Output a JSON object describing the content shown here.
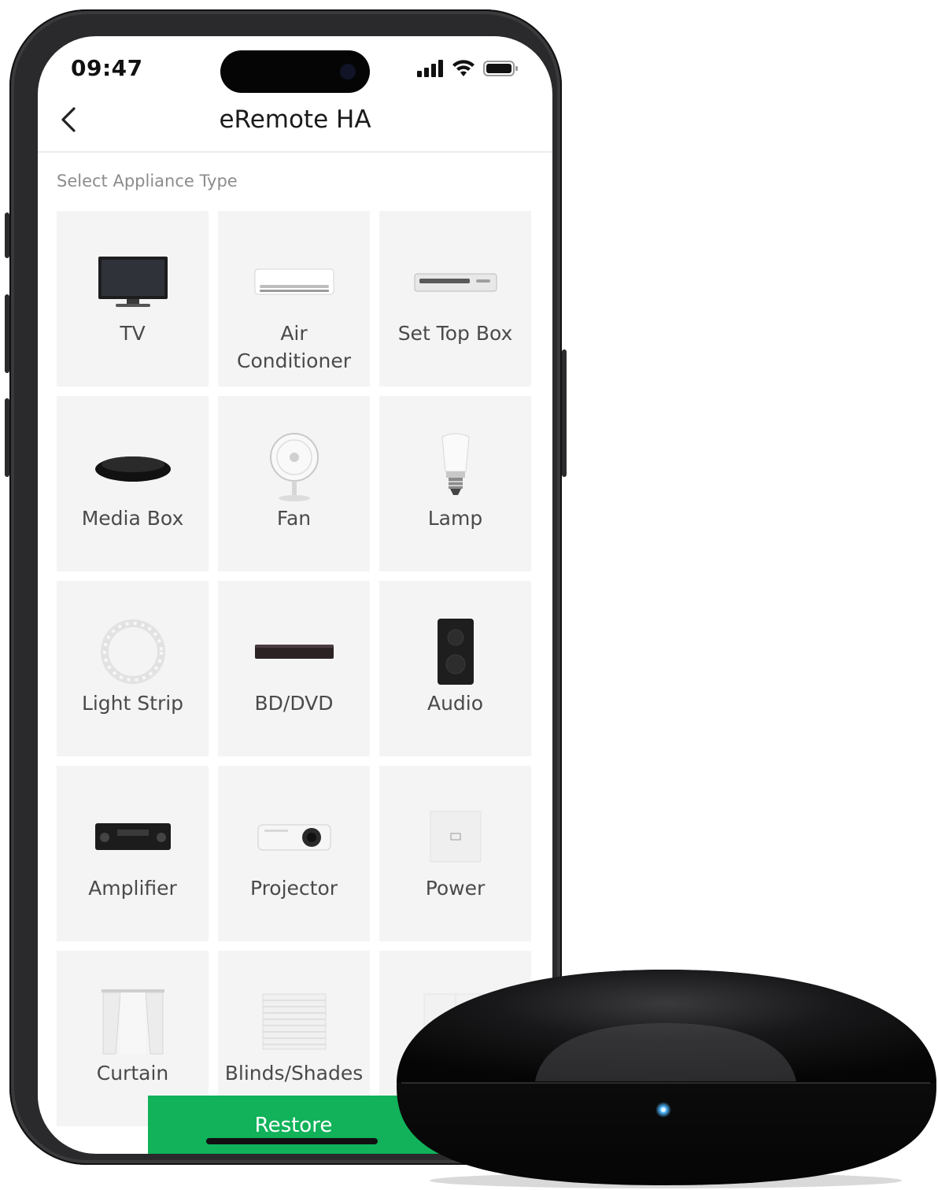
{
  "status_bar": {
    "time": "09:47",
    "icons": [
      "signal-icon",
      "wifi-icon",
      "battery-icon"
    ]
  },
  "header": {
    "back_icon": "chevron-left-icon",
    "title": "eRemote HA"
  },
  "section_label": "Select Appliance Type",
  "appliances": [
    {
      "label": "TV",
      "icon": "tv-icon"
    },
    {
      "label": "Air Conditioner",
      "icon": "air-conditioner-icon"
    },
    {
      "label": "Set Top Box",
      "icon": "set-top-box-icon"
    },
    {
      "label": "Media Box",
      "icon": "media-box-icon"
    },
    {
      "label": "Fan",
      "icon": "fan-icon"
    },
    {
      "label": "Lamp",
      "icon": "lamp-icon"
    },
    {
      "label": "Light Strip",
      "icon": "light-strip-icon"
    },
    {
      "label": "BD/DVD",
      "icon": "bd-dvd-icon"
    },
    {
      "label": "Audio",
      "icon": "audio-speaker-icon"
    },
    {
      "label": "Amplifier",
      "icon": "amplifier-icon"
    },
    {
      "label": "Projector",
      "icon": "projector-icon"
    },
    {
      "label": "Power",
      "icon": "power-outlet-icon"
    },
    {
      "label": "Curtain",
      "icon": "curtain-icon"
    },
    {
      "label": "Blinds/Shades",
      "icon": "blinds-icon"
    },
    {
      "label": "",
      "icon": "switch-icon"
    }
  ],
  "restore_button": "Restore",
  "colors": {
    "accent": "#11b25a",
    "tile_bg": "#f4f4f4",
    "hub": "#0b0b0c",
    "hub_led": "#4fb8ff"
  }
}
